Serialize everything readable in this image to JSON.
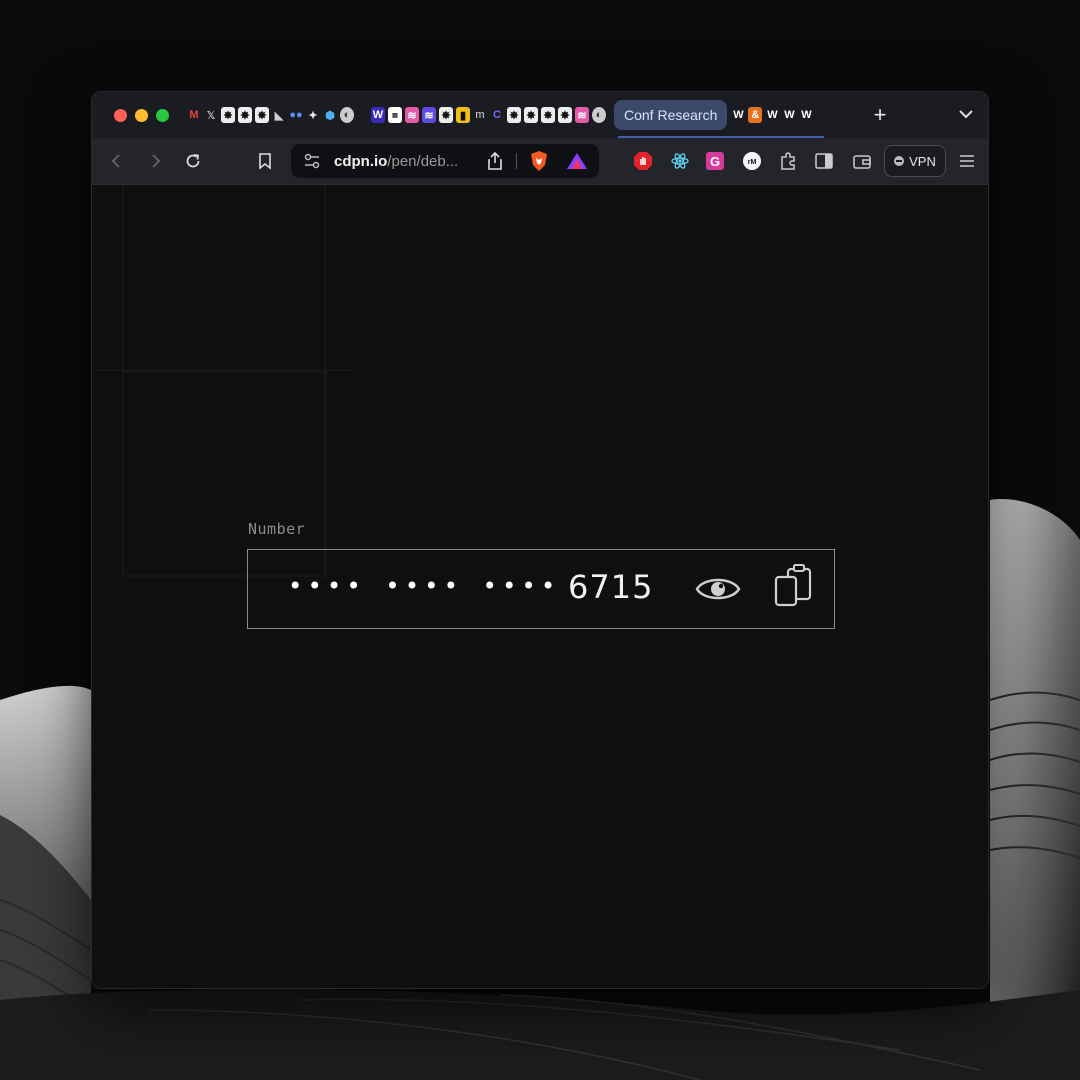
{
  "browser": {
    "active_tab": "Conf Research",
    "favicons": [
      "M",
      "X",
      "",
      "",
      "",
      "",
      "",
      "",
      "",
      "",
      "W",
      "",
      "",
      "",
      "",
      "m",
      "",
      "",
      "",
      "",
      "",
      "",
      ""
    ],
    "right_favicons": [
      "W",
      "&",
      "W",
      "W",
      "W"
    ],
    "url_domain": "cdpn.io",
    "url_path": "/pen/deb...",
    "vpn_label": "VPN"
  },
  "form": {
    "label": "Number",
    "masked_digits": "•••• •••• ••••",
    "last_four": "6715"
  },
  "icons": {
    "reveal": "eye-icon",
    "copy": "clipboard-copy-icon"
  }
}
